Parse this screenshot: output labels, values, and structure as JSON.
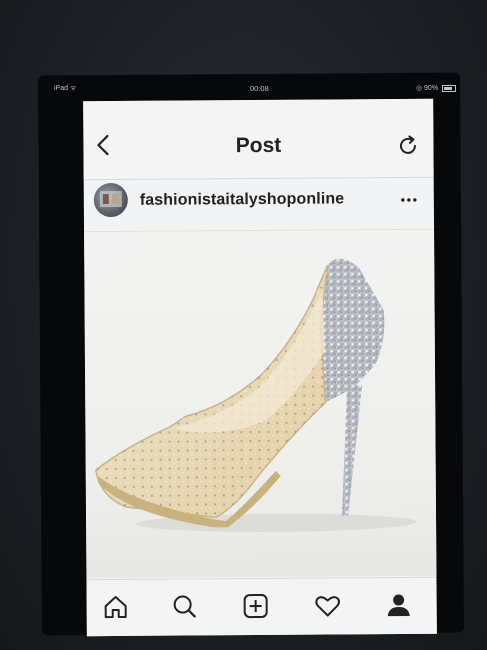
{
  "status_bar": {
    "device": "iPad",
    "time": "00:08",
    "battery": "90%"
  },
  "header": {
    "title": "Post",
    "back_icon": "chevron-left-icon",
    "refresh_icon": "refresh-icon"
  },
  "post": {
    "username": "fashionistaitalyshoponline",
    "more_icon": "ellipsis-icon",
    "image": "photo of a nude mesh high-heel pump with crystal embellishments and a glittering silver heel"
  },
  "tab_bar": {
    "items": [
      "home-icon",
      "search-icon",
      "add-post-icon",
      "heart-icon",
      "profile-icon"
    ]
  },
  "colors": {
    "screen_bg": "#f2f3f4",
    "text": "#222222",
    "bezel": "#07080a"
  }
}
